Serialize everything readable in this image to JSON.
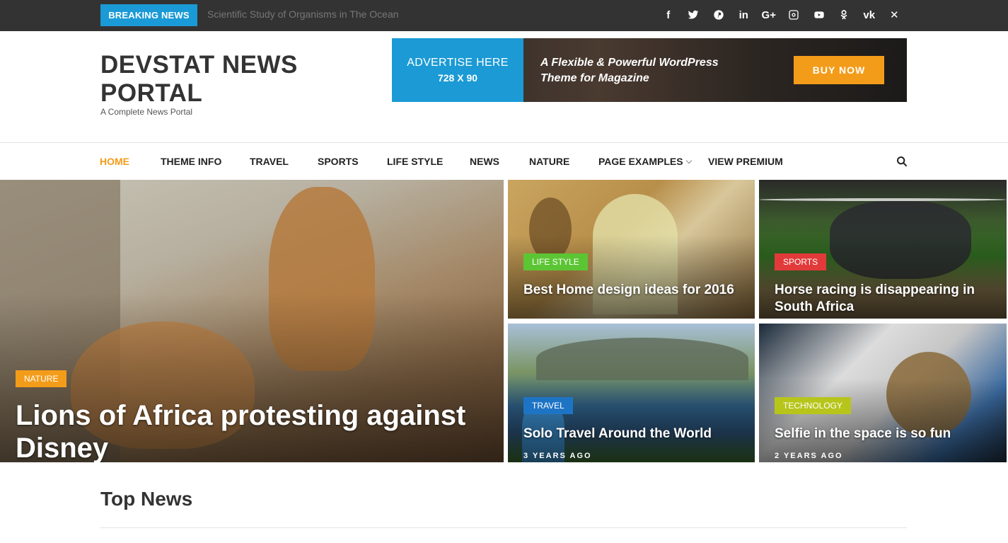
{
  "topbar": {
    "breaking_label": "BREAKING NEWS",
    "breaking_headline": "Scientific Study of Organisms in The Ocean",
    "social_icons": [
      "facebook-icon",
      "twitter-icon",
      "pinterest-icon",
      "linkedin-icon",
      "google-plus-icon",
      "instagram-icon",
      "youtube-icon",
      "odnoklassniki-icon",
      "vk-icon",
      "xing-icon"
    ]
  },
  "header": {
    "site_title": "DEVSTAT NEWS PORTAL",
    "tagline": "A Complete News Portal",
    "ad": {
      "left_line1": "ADVERTISE HERE",
      "left_line2": "728 X 90",
      "mid_line1": "A Flexible & Powerful WordPress",
      "mid_line2": "Theme for Magazine",
      "button": "BUY NOW"
    }
  },
  "nav": {
    "items": [
      "HOME",
      "THEME INFO",
      "TRAVEL",
      "SPORTS",
      "LIFE STYLE",
      "NEWS",
      "NATURE",
      "PAGE EXAMPLES",
      "VIEW PREMIUM"
    ],
    "active": "HOME"
  },
  "featured": {
    "main": {
      "category": "NATURE",
      "title": "Lions of Africa protesting against Disney"
    },
    "tile_a": {
      "category": "LIFE STYLE",
      "title": "Best Home design ideas for 2016"
    },
    "tile_b": {
      "category": "SPORTS",
      "title": "Horse racing is disappearing in South Africa"
    },
    "tile_c": {
      "category": "TRAVEL",
      "title": "Solo Travel Around the World",
      "meta": "3 YEARS AGO"
    },
    "tile_d": {
      "category": "TECHNOLOGY",
      "title": "Selfie in the space is so fun",
      "meta": "2 YEARS AGO"
    }
  },
  "section": {
    "top_news": "Top News"
  },
  "colors": {
    "accent": "#f39c1a",
    "breaking": "#1a9ad6",
    "lifestyle": "#5cc534",
    "sports": "#e23a3a",
    "travel": "#1e74c4",
    "technology": "#b7c51a"
  }
}
